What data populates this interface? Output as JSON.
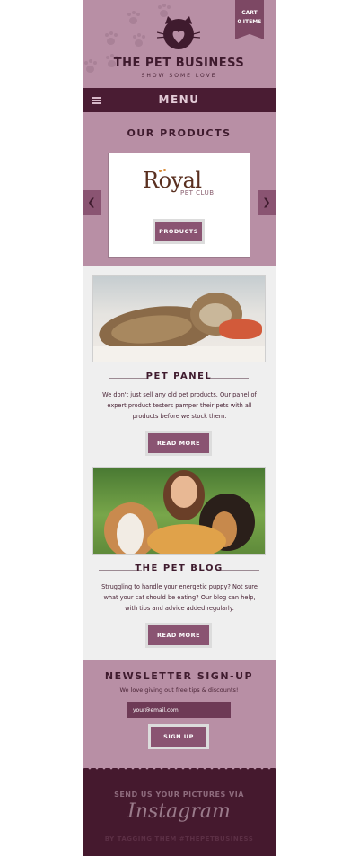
{
  "brand": {
    "title": "THE PET BUSINESS",
    "tagline": "SHOW SOME LOVE"
  },
  "cart": {
    "line1": "CART",
    "line2": "0 ITEMS"
  },
  "menu": {
    "label": "MENU"
  },
  "products": {
    "title": "OUR PRODUCTS",
    "brand_name": "Royal",
    "brand_sub": "PET CLUB",
    "button": "PRODUCTS",
    "prev": "❮",
    "next": "❯"
  },
  "features": [
    {
      "title": "PET PANEL",
      "text": "We don't just sell any old pet products. Our panel of expert product testers pamper their pets with all products before we stock them.",
      "button": "READ MORE"
    },
    {
      "title": "THE PET BLOG",
      "text": "Struggling to handle your energetic puppy? Not sure what your cat should be eating? Our blog can help, with tips and advice added regularly.",
      "button": "READ MORE"
    }
  ],
  "newsletter": {
    "title": "NEWSLETTER SIGN-UP",
    "subtitle": "We love giving out free tips & discounts!",
    "email_value": "your@email.com",
    "button": "SIGN UP"
  },
  "footer": {
    "line1": "SEND US YOUR PICTURES VIA",
    "instagram": "Instagram",
    "line2": "BY TAGGING THEM #THEPETBUSINESS"
  },
  "colors": {
    "mauve": "#b88fa5",
    "plum": "#4a1c33",
    "button": "#8a5472",
    "panel_bg": "#efefef"
  }
}
